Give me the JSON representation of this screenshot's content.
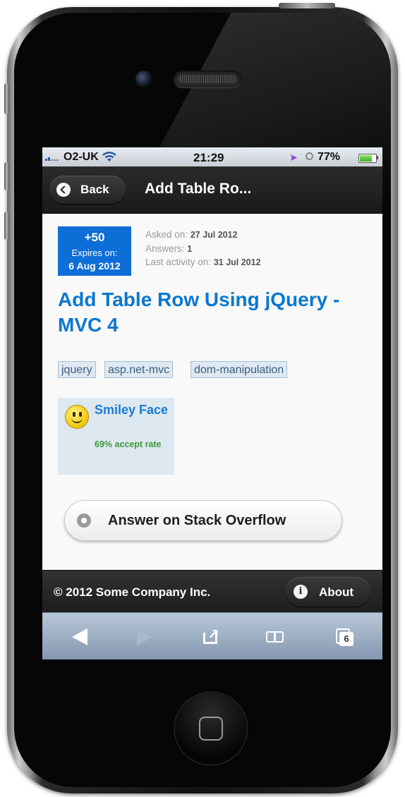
{
  "status_bar": {
    "carrier": "O2-UK",
    "time": "21:29",
    "battery_percent": "77%",
    "battery_level": 0.77,
    "icons": [
      "signal-icon",
      "wifi-icon",
      "location-icon",
      "alarm-icon",
      "battery-icon"
    ]
  },
  "header": {
    "back_label": "Back",
    "title": "Add Table Ro..."
  },
  "question": {
    "bounty": {
      "amount": "+50",
      "expires_label": "Expires on:",
      "expires_date": "6 Aug 2012",
      "color": "#0d6ed8"
    },
    "meta": {
      "asked_label": "Asked on:",
      "asked_value": "27 Jul 2012",
      "answers_label": "Answers:",
      "answers_value": "1",
      "activity_label": "Last activity on:",
      "activity_value": "31 Jul 2012"
    },
    "title": "Add Table Row Using jQuery - MVC 4",
    "tags": [
      "jquery",
      "asp.net-mvc",
      "dom-manipulation"
    ],
    "user": {
      "name": "Smiley Face",
      "accept_rate": "69% accept rate"
    },
    "answer_button_label": "Answer on Stack Overflow"
  },
  "footer": {
    "copyright": "© 2012 Some Company Inc.",
    "about_label": "About",
    "info_glyph": "i"
  },
  "toolbar": {
    "tab_count": "6",
    "icons": [
      "back-arrow-icon",
      "forward-arrow-icon",
      "share-icon",
      "bookmarks-icon",
      "tabs-icon"
    ]
  },
  "colors": {
    "link_blue": "#0a77d2",
    "accept_green": "#3e9a37",
    "tag_background": "#dfe9f2"
  }
}
